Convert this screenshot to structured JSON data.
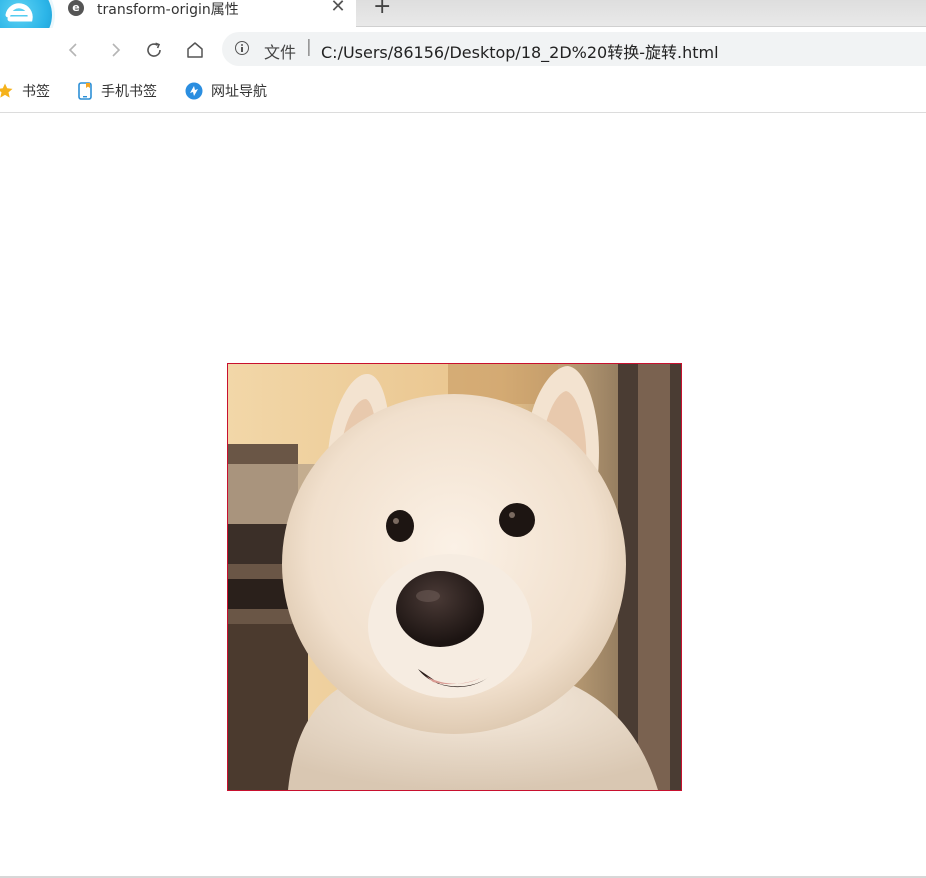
{
  "browser": {
    "logo_name": "browser-logo",
    "tab": {
      "title": "transform-origin属性",
      "favicon_letter": "e"
    },
    "new_tab_symbol": "+",
    "close_symbol": "✕"
  },
  "toolbar": {
    "address": {
      "scheme_label": "文件",
      "separator": "|",
      "url": "C:/Users/86156/Desktop/18_2D%20转换-旋转.html"
    }
  },
  "bookmarks": [
    {
      "label": "书签",
      "icon": "star-icon"
    },
    {
      "label": "手机书签",
      "icon": "phone-bookmark-icon"
    },
    {
      "label": "网址导航",
      "icon": "nav-site-icon"
    }
  ],
  "content": {
    "image": {
      "subject": "white-fluffy-dog",
      "border_color": "#c8102e"
    }
  },
  "colors": {
    "accent": "#2cb5e8",
    "border_red": "#c8102e"
  }
}
